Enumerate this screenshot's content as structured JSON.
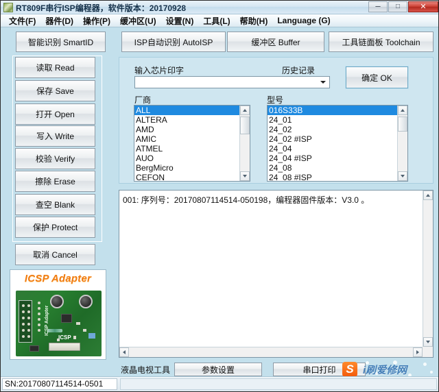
{
  "window": {
    "title": "RT809F串行ISP编程器，软件版本：20170928",
    "icon": "app-icon",
    "controls": {
      "minimize": "–",
      "maximize": "□",
      "close": "✕"
    }
  },
  "menubar": {
    "items": [
      {
        "label": "文件(F)",
        "name": "menu-file"
      },
      {
        "label": "器件(D)",
        "name": "menu-device"
      },
      {
        "label": "操作(P)",
        "name": "menu-operation"
      },
      {
        "label": "缓冲区(U)",
        "name": "menu-buffer"
      },
      {
        "label": "设置(N)",
        "name": "menu-settings"
      },
      {
        "label": "工具(L)",
        "name": "menu-tools"
      },
      {
        "label": "帮助(H)",
        "name": "menu-help"
      },
      {
        "label": "Language (G)",
        "name": "menu-language"
      }
    ]
  },
  "toolbar": {
    "smartid": "智能识别 SmartID",
    "autoisp": "ISP自动识别 AutoISP",
    "buffer": "缓冲区 Buffer",
    "toolchain": "工具链面板 Toolchain"
  },
  "sidebar": {
    "buttons": [
      {
        "label": "读取 Read",
        "name": "read-button"
      },
      {
        "label": "保存 Save",
        "name": "save-button"
      },
      {
        "label": "打开 Open",
        "name": "open-button"
      },
      {
        "label": "写入 Write",
        "name": "write-button"
      },
      {
        "label": "校验 Verify",
        "name": "verify-button"
      },
      {
        "label": "擦除 Erase",
        "name": "erase-button"
      },
      {
        "label": "查空 Blank",
        "name": "blank-button"
      },
      {
        "label": "保护 Protect",
        "name": "protect-button"
      }
    ],
    "cancel": "取消 Cancel"
  },
  "icsp": {
    "title": "ICSP Adapter",
    "board_label_vertical": "ICSP Adapter",
    "board_label_bottom": "ICSP"
  },
  "chip_panel": {
    "input_label": "输入芯片印字",
    "history_label": "历史记录",
    "search_value": "",
    "search_placeholder": "",
    "ok_button": "确定 OK",
    "manufacturer_label": "厂商",
    "model_label": "型号",
    "manufacturers": [
      "ALL",
      "ALTERA",
      "AMD",
      "AMIC",
      "ATMEL",
      "AUO",
      "BergMicro",
      "CEFON"
    ],
    "manufacturer_selected": "ALL",
    "models": [
      "016S33B",
      "24_01",
      "24_02",
      "24_02 #ISP",
      "24_04",
      "24_04 #ISP",
      "24_08",
      "24_08 #ISP"
    ],
    "model_selected": "016S33B"
  },
  "log": {
    "lines": [
      "001: 序列号：20170807114514-050198，编程器固件版本：V3.0 。"
    ]
  },
  "bottombar": {
    "lcd_tool_label": "液晶电视工具",
    "param_settings": "参数设置",
    "serial_print": "串口打印"
  },
  "watermark": {
    "logo": "S",
    "text": "i刷爱修网"
  },
  "statusbar": {
    "serial": "SN:20170807114514-0501"
  },
  "colors": {
    "background": "#c3e0ec",
    "panel": "#cfe6f0",
    "selection": "#1f8ae0",
    "accent_orange": "#f07c12",
    "close_red": "#cf4338"
  }
}
